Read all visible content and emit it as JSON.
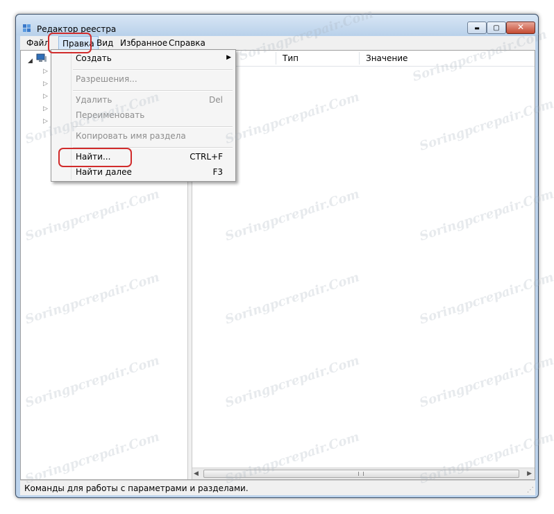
{
  "window": {
    "title": "Редактор реестра",
    "controls": {
      "minimize": "▬",
      "maximize": "▢",
      "close": "✕"
    }
  },
  "menubar": {
    "items": [
      "Файл",
      "Правка",
      "Вид",
      "Избранное",
      "Справка"
    ]
  },
  "list": {
    "columns": [
      "Тип",
      "Значение"
    ]
  },
  "edit_menu": {
    "items": [
      {
        "label": "Создать",
        "shortcut": "",
        "submenu_arrow": "▶",
        "disabled": false
      },
      {
        "label": "Разрешения...",
        "shortcut": "",
        "disabled": true
      },
      {
        "label": "Удалить",
        "shortcut": "Del",
        "disabled": true
      },
      {
        "label": "Переименовать",
        "shortcut": "",
        "disabled": true
      },
      {
        "label": "Копировать имя раздела",
        "shortcut": "",
        "disabled": true
      },
      {
        "label": "Найти...",
        "shortcut": "CTRL+F",
        "disabled": false
      },
      {
        "label": "Найти далее",
        "shortcut": "F3",
        "disabled": false
      }
    ]
  },
  "tree": {
    "expander_glyph": "◢",
    "child_glyph": "▷"
  },
  "scrollbar": {
    "left_arrow": "◀",
    "right_arrow": "▶"
  },
  "status": {
    "text": "Команды для работы с параметрами и разделами."
  },
  "watermark": {
    "text": "Soringpcrepair.Com"
  },
  "colors": {
    "highlight": "#d12b2b",
    "menu_active": "#d7e8fa"
  }
}
